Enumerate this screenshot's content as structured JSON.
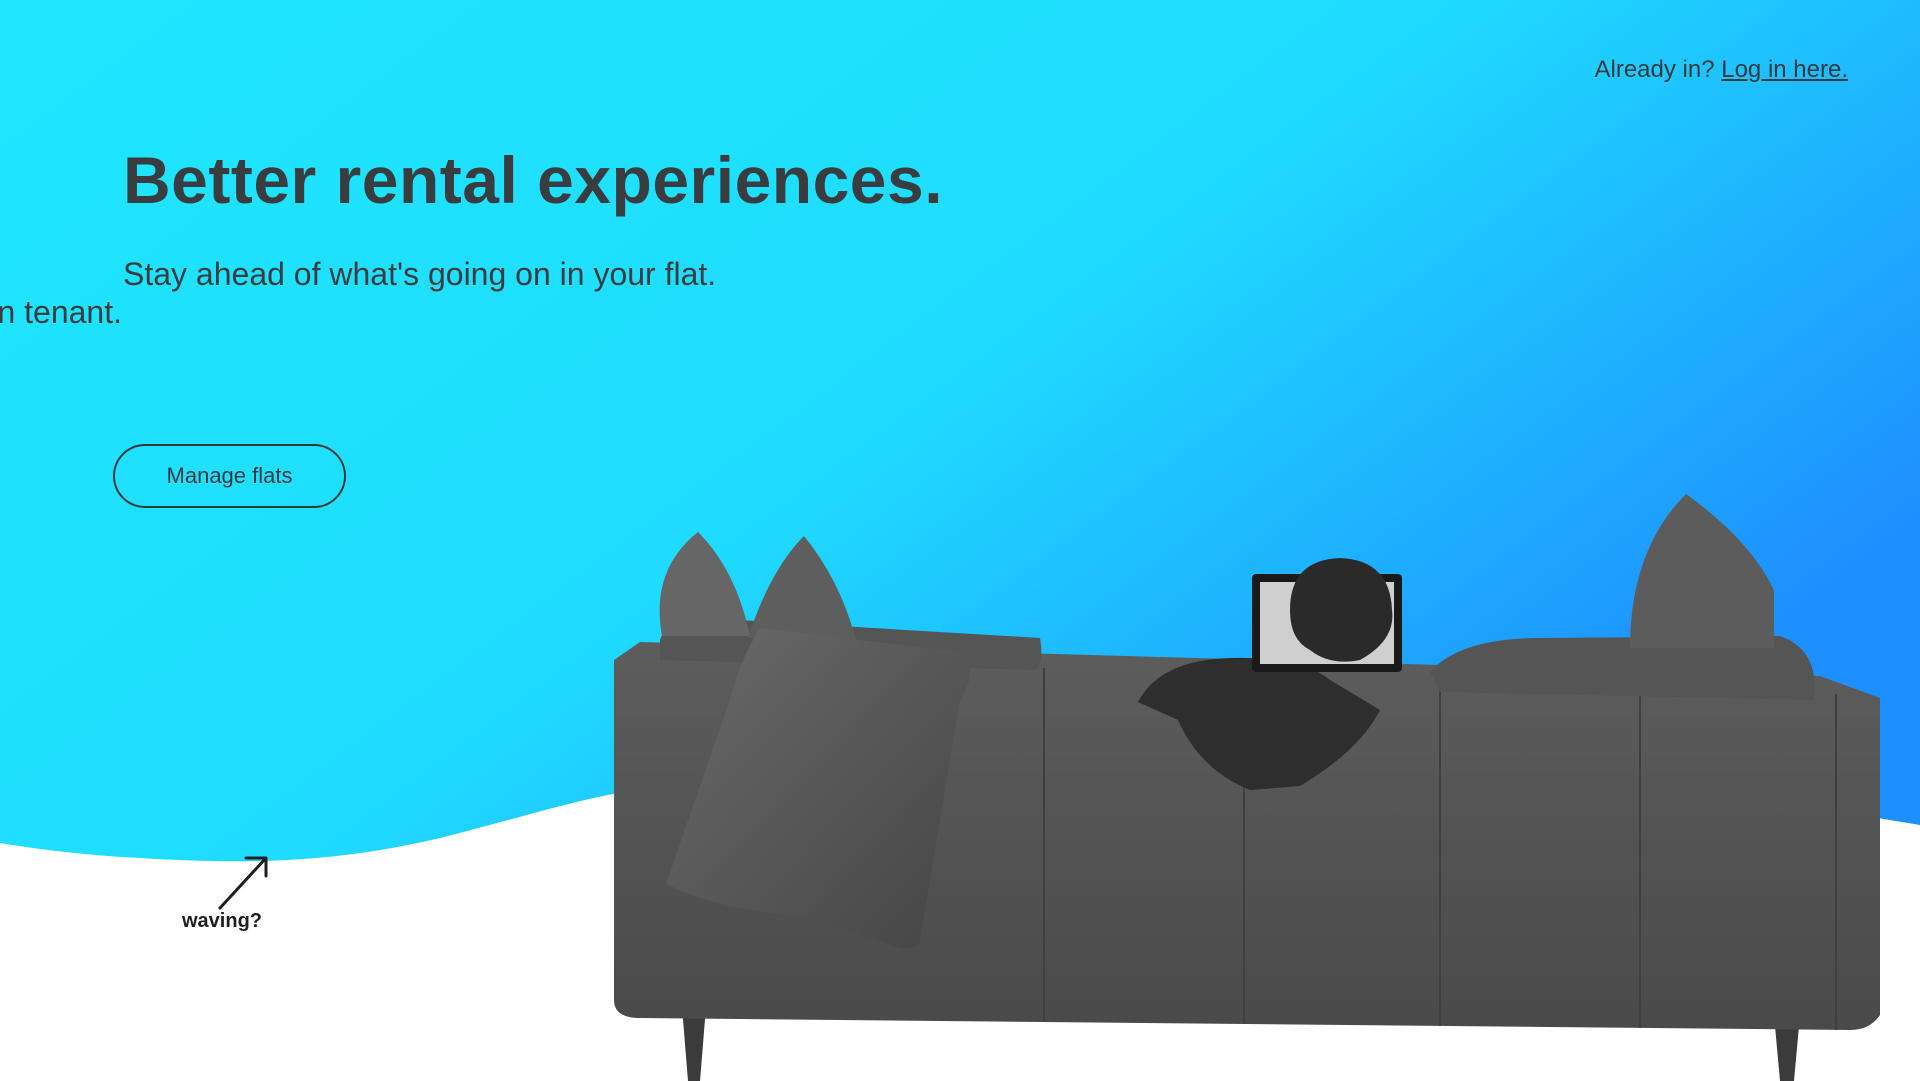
{
  "header": {
    "login_prompt": "Already in?",
    "login_link": "Log in here."
  },
  "hero": {
    "headline": "Better rental experiences.",
    "subline": "Stay ahead of what's going on in your flat.",
    "rotating_fragment": "n tenant.",
    "cta_label": "Manage flats"
  },
  "annotation": {
    "label": "waving?",
    "icon": "arrow-up-right-icon"
  },
  "illustration": {
    "subject": "sofa-photo"
  },
  "colors": {
    "gradient_start": "#1fe6ff",
    "gradient_end": "#1e8fff",
    "text": "#3a3d40",
    "white": "#ffffff"
  }
}
